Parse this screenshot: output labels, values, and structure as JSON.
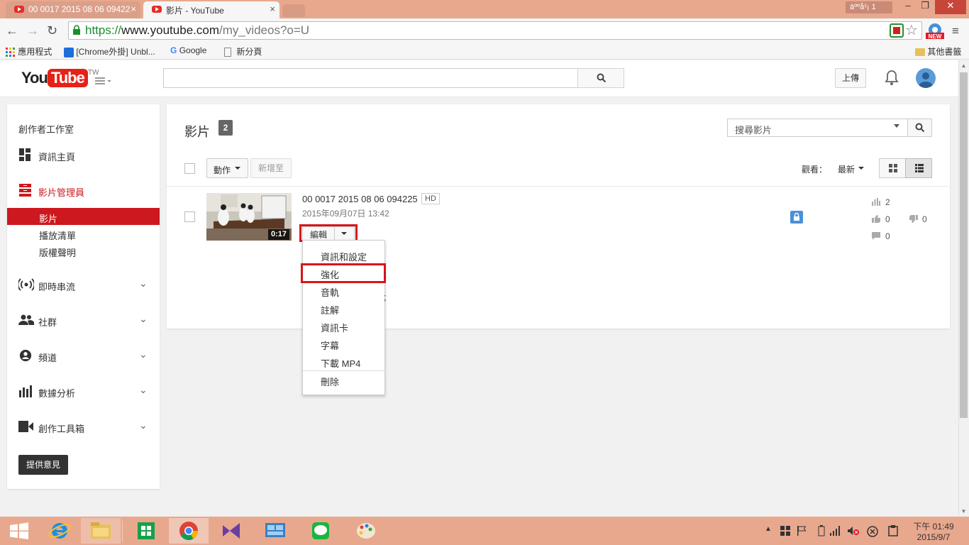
{
  "browser": {
    "tabs": [
      {
        "title": "00 0017 2015 08 06 09422",
        "active": false
      },
      {
        "title": "影片 - YouTube",
        "active": true
      }
    ],
    "tab_close": "×",
    "user_badge": "äººå¹¡ 1",
    "window_controls": {
      "minimize": "–",
      "maximize": "❐",
      "close": "✕"
    },
    "nav": {
      "back": "←",
      "forward": "→",
      "reload": "↻"
    },
    "url": {
      "scheme": "https://",
      "host": "www.youtube.com",
      "path": "/my_videos?o=U"
    },
    "star": "☆",
    "menu": "≡",
    "bookmarks": [
      {
        "label": "應用程式"
      },
      {
        "label": "[Chrome外掛] Unbl..."
      },
      {
        "label": "Google"
      },
      {
        "label": "新分頁"
      }
    ],
    "other_bookmarks": "其他書籤"
  },
  "header": {
    "logo_you": "You",
    "logo_tube": "Tube",
    "logo_region": "TW",
    "upload_label": "上傳"
  },
  "sidebar": {
    "studio": "創作者工作室",
    "dashboard": "資訊主頁",
    "video_manager": "影片管理員",
    "sub_items": [
      "影片",
      "播放清單",
      "版權聲明"
    ],
    "sections": [
      "即時串流",
      "社群",
      "頻道",
      "數據分析",
      "創作工具箱"
    ],
    "feedback": "提供意見"
  },
  "main": {
    "title": "影片",
    "count": "2",
    "search_placeholder": "搜尋影片",
    "action_label": "動作",
    "add_to_label": "新增至",
    "view_label": "觀看：",
    "sort_value": "最新",
    "video": {
      "title": "00 0017 2015 08 06 094225",
      "badge": "HD",
      "date": "2015年09月07日 13:42",
      "duration": "0:17",
      "edit_label": "編輯",
      "views": "2",
      "likes": "0",
      "dislikes": "0",
      "comments": "0"
    },
    "dropdown": [
      "資訊和設定",
      "強化",
      "音軌",
      "註解",
      "資訊卡",
      "字幕",
      "下載 MP4",
      "刪除"
    ],
    "dropdown_highlighted": "強化",
    "stray_marks": [
      ":",
      ";"
    ]
  },
  "taskbar": {
    "time": "下午 01:49",
    "date": "2015/9/7",
    "tray_up": "▲"
  },
  "colors": {
    "accent_red": "#cc181e",
    "highlight_box": "#d9151c",
    "titlebar": "#e8a88e"
  }
}
